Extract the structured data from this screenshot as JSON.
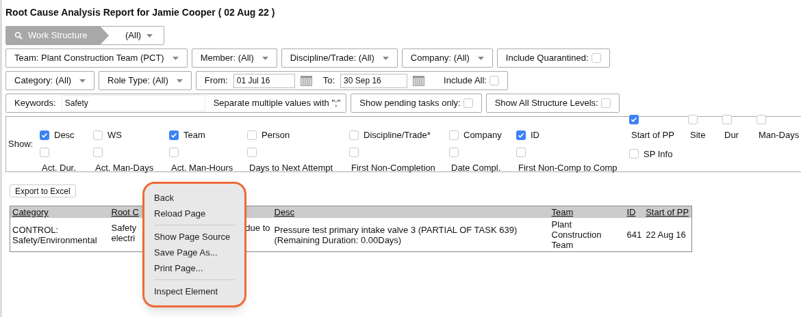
{
  "title": "Root Cause Analysis Report for Jamie Cooper ( 02 Aug 22 )",
  "work_structure": {
    "label": "Work Structure",
    "value": "(All)"
  },
  "filter_rows": [
    [
      {
        "kind": "dropdown",
        "label": "Team:",
        "value": "Plant Construction Team (PCT)"
      },
      {
        "kind": "dropdown",
        "label": "Member:",
        "value": "(All)"
      },
      {
        "kind": "dropdown",
        "label": "Discipline/Trade:",
        "value": "(All)"
      },
      {
        "kind": "dropdown",
        "label": "Company:",
        "value": "(All)"
      },
      {
        "kind": "checkbox",
        "label": "Include Quarantined:",
        "checked": false
      }
    ],
    [
      {
        "kind": "dropdown",
        "label": "Category:",
        "value": "(All)"
      },
      {
        "kind": "dropdown",
        "label": "Role Type:",
        "value": "(All)"
      },
      {
        "kind": "daterange",
        "from_label": "From:",
        "from_value": "01 Jul 16",
        "to_label": "To:",
        "to_value": "30 Sep 16",
        "all_label": "Include All:",
        "all_checked": false
      }
    ],
    [
      {
        "kind": "keywords",
        "label": "Keywords:",
        "value": "Safety",
        "hint": "Separate multiple values with \";\""
      },
      {
        "kind": "checkbox",
        "label": "Show pending tasks only:",
        "checked": false
      },
      {
        "kind": "checkbox",
        "label": "Show All Structure Levels:",
        "checked": false
      }
    ]
  ],
  "show": {
    "label": "Show:",
    "rows": [
      [
        {
          "label": "Desc",
          "checked": true,
          "kind": "inline"
        },
        {
          "label": "WS",
          "checked": false,
          "kind": "inline"
        },
        {
          "label": "Team",
          "checked": true,
          "kind": "inline"
        },
        {
          "label": "Person",
          "checked": false,
          "kind": "inline"
        },
        {
          "label": "Discipline/Trade*",
          "checked": false,
          "kind": "inline"
        },
        {
          "label": "Company",
          "checked": false,
          "kind": "inline"
        },
        {
          "label": "ID",
          "checked": true,
          "kind": "inline"
        },
        {
          "label": "Start of PP",
          "checked": true,
          "kind": "stacked"
        },
        {
          "label": "Site",
          "checked": false,
          "kind": "stacked"
        },
        {
          "label": "Dur",
          "checked": false,
          "kind": "stacked"
        },
        {
          "label": "Man-Days",
          "checked": false,
          "kind": "stacked"
        }
      ],
      [
        {
          "label": "Act. Dur.",
          "checked": false,
          "kind": "stacked"
        },
        {
          "label": "Act. Man-Days",
          "checked": false,
          "kind": "stacked"
        },
        {
          "label": "Act. Man-Hours",
          "checked": false,
          "kind": "stacked"
        },
        {
          "label": "Days to Next Attempt",
          "checked": false,
          "kind": "stacked"
        },
        {
          "label": "First Non-Completion",
          "checked": false,
          "kind": "stacked"
        },
        {
          "label": "Date Compl.",
          "checked": false,
          "kind": "stacked"
        },
        {
          "label": "First Non-Comp to Comp",
          "checked": false,
          "kind": "stacked"
        },
        {
          "label": "SP Info",
          "checked": false,
          "kind": "inline"
        }
      ]
    ]
  },
  "export_button": "Export to Excel",
  "table": {
    "columns": [
      "Category",
      "Root C",
      "Desc",
      "Team",
      "ID",
      "Start of PP"
    ],
    "rows": [
      {
        "category": [
          "CONTROL:",
          "Safety/Environmental"
        ],
        "root_cause": {
          "line1_start": "Safety",
          "line1_end": "due to",
          "line2_start": "electri"
        },
        "desc": [
          "Pressure test primary intake valve 3 (PARTIAL OF TASK 639)",
          "(Remaining Duration: 0.00Days)"
        ],
        "team": [
          "Plant",
          "Construction",
          "Team"
        ],
        "id": "641",
        "start_of_pp": "22 Aug 16"
      }
    ]
  },
  "context_menu": {
    "groups": [
      [
        "Back",
        "Reload Page"
      ],
      [
        "Show Page Source",
        "Save Page As...",
        "Print Page..."
      ],
      [
        "Inspect Element"
      ]
    ]
  }
}
